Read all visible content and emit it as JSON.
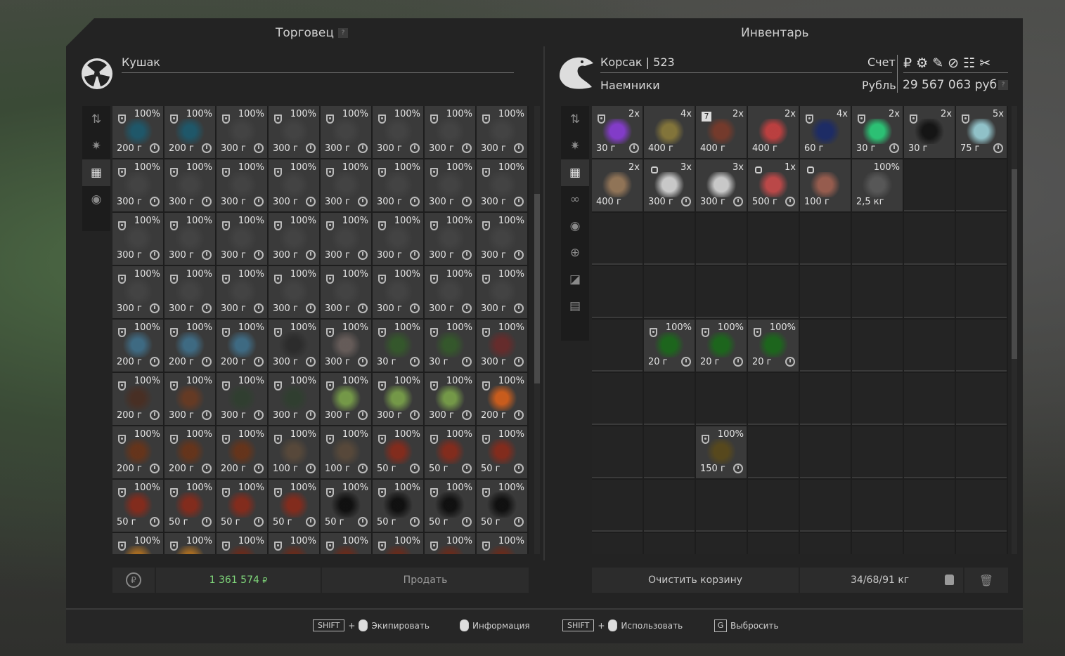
{
  "trader_panel": {
    "title": "Торговец",
    "help": "?",
    "name": "Кушак",
    "total": "1 361 574",
    "currency_icon": "₽",
    "sell_label": "Продать"
  },
  "inventory_panel": {
    "title": "Инвентарь",
    "player": "Корсак | 523",
    "faction": "Наемники",
    "account_label": "Счет",
    "currency_label": "Рубль",
    "balance": "29 567 063 руб.",
    "help": "?",
    "currency_symbols": "₽ ⚙ ✎ ⊘ ☷ ✂",
    "clear_label": "Очистить корзину",
    "weight": "34/68/91 кг"
  },
  "colors": {
    "accent_green": "#7fd67a",
    "frame": "#232323"
  },
  "trader_items": [
    [
      "200 г",
      "200 г",
      "300 г",
      "300 г",
      "300 г",
      "300 г",
      "300 г",
      "300 г"
    ],
    [
      "300 г",
      "300 г",
      "300 г",
      "300 г",
      "300 г",
      "300 г",
      "300 г",
      "300 г"
    ],
    [
      "300 г",
      "300 г",
      "300 г",
      "300 г",
      "300 г",
      "300 г",
      "300 г",
      "300 г"
    ],
    [
      "300 г",
      "300 г",
      "300 г",
      "300 г",
      "300 г",
      "300 г",
      "300 г",
      "300 г"
    ],
    [
      "200 г",
      "200 г",
      "200 г",
      "300 г",
      "300 г",
      "30 г",
      "30 г",
      "300 г"
    ],
    [
      "200 г",
      "300 г",
      "300 г",
      "300 г",
      "300 г",
      "300 г",
      "300 г",
      "200 г"
    ],
    [
      "200 г",
      "200 г",
      "200 г",
      "100 г",
      "100 г",
      "50 г",
      "50 г",
      "50 г"
    ],
    [
      "50 г",
      "50 г",
      "50 г",
      "50 г",
      "50 г",
      "50 г",
      "50 г",
      "50 г"
    ],
    [
      "",
      "",
      "",
      "",
      "",
      "",
      "",
      ""
    ]
  ],
  "trader_colors": [
    [
      "#1c5a6e",
      "#1c5a6e",
      "#444",
      "#444",
      "#444",
      "#444",
      "#444",
      "#444"
    ],
    [
      "#444",
      "#444",
      "#444",
      "#444",
      "#444",
      "#444",
      "#444",
      "#444"
    ],
    [
      "#444",
      "#444",
      "#444",
      "#444",
      "#444",
      "#444",
      "#444",
      "#444"
    ],
    [
      "#444",
      "#444",
      "#444",
      "#444",
      "#444",
      "#444",
      "#444",
      "#444"
    ],
    [
      "#3f6f8a",
      "#3f6f8a",
      "#3f6f8a",
      "#2a2a2a",
      "#6a5f5c",
      "#345a2a",
      "#345a2a",
      "#6a2a2a"
    ],
    [
      "#4a2e22",
      "#6a3a22",
      "#2f3f2f",
      "#2f3f2f",
      "#7aa24a",
      "#7aa24a",
      "#7aa24a",
      "#d8601a"
    ],
    [
      "#6a3418",
      "#6a3418",
      "#6a3418",
      "#5a4a3a",
      "#5a4a3a",
      "#8a2a1a",
      "#8a2a1a",
      "#8a2a1a"
    ],
    [
      "#8a2a1a",
      "#8a2a1a",
      "#8a2a1a",
      "#8a2a1a",
      "#0c0c0c",
      "#0c0c0c",
      "#0c0c0c",
      "#0c0c0c"
    ],
    [
      "#b07020",
      "#b07020",
      "#6a2a1a",
      "#6a2a1a",
      "#6a2a1a",
      "#6a2a1a",
      "#6a2a1a",
      "#6a2a1a"
    ]
  ],
  "pct_label": "100%",
  "inventory_items": [
    {
      "c": 0,
      "r": 0,
      "count": "2x",
      "price": "30 г",
      "color": "#8a3cd8",
      "shield": true,
      "clock": true
    },
    {
      "c": 1,
      "r": 0,
      "count": "4x",
      "price": "400 г",
      "color": "#8a7a3a"
    },
    {
      "c": 2,
      "r": 0,
      "count": "2x",
      "price": "400 г",
      "color": "#7a3a2a",
      "badge": "7"
    },
    {
      "c": 3,
      "r": 0,
      "count": "2x",
      "price": "400 г",
      "color": "#c84040"
    },
    {
      "c": 4,
      "r": 0,
      "count": "4x",
      "price": "60 г",
      "color": "#1a2a6a",
      "shield": true
    },
    {
      "c": 5,
      "r": 0,
      "count": "2x",
      "price": "30 г",
      "color": "#2acf7a",
      "shield": true,
      "clock": true
    },
    {
      "c": 6,
      "r": 0,
      "count": "2x",
      "price": "30 г",
      "color": "#111",
      "shield": true
    },
    {
      "c": 7,
      "r": 0,
      "count": "5x",
      "price": "75 г",
      "color": "#9ad0d8",
      "shield": true,
      "clock": true
    },
    {
      "c": 0,
      "r": 1,
      "count": "2x",
      "price": "400 г",
      "color": "#9a7a5a"
    },
    {
      "c": 1,
      "r": 1,
      "count": "3x",
      "price": "300 г",
      "color": "#d8d8d8",
      "lock": true,
      "clock": true
    },
    {
      "c": 2,
      "r": 1,
      "count": "3x",
      "price": "300 г",
      "color": "#d8d8d8",
      "clock": true
    },
    {
      "c": 3,
      "r": 1,
      "count": "1x",
      "price": "500 г",
      "color": "#c84a4a",
      "lock": true,
      "clock": true
    },
    {
      "c": 4,
      "r": 1,
      "count": "",
      "price": "100 г",
      "color": "#a06050",
      "lock": true
    },
    {
      "c": 5,
      "r": 1,
      "pct": true,
      "price": "2,5 кг",
      "color": "#5a5a5a"
    },
    {
      "c": 1,
      "r": 4,
      "pct": true,
      "price": "20 г",
      "color": "#1a6a1a",
      "shield": true,
      "clock": true
    },
    {
      "c": 2,
      "r": 4,
      "pct": true,
      "price": "20 г",
      "color": "#1a6a1a",
      "shield": true,
      "clock": true
    },
    {
      "c": 3,
      "r": 4,
      "pct": true,
      "price": "20 г",
      "color": "#1a6a1a",
      "shield": true,
      "clock": true
    },
    {
      "c": 2,
      "r": 6,
      "pct": true,
      "price": "150 г",
      "color": "#5a4a1a",
      "shield": true,
      "clock": true
    }
  ],
  "keys": {
    "shift": "SHIFT",
    "plus": "+",
    "equip": "Экипировать",
    "info": "Информация",
    "use": "Использовать",
    "g": "G",
    "drop": "Выбросить"
  }
}
